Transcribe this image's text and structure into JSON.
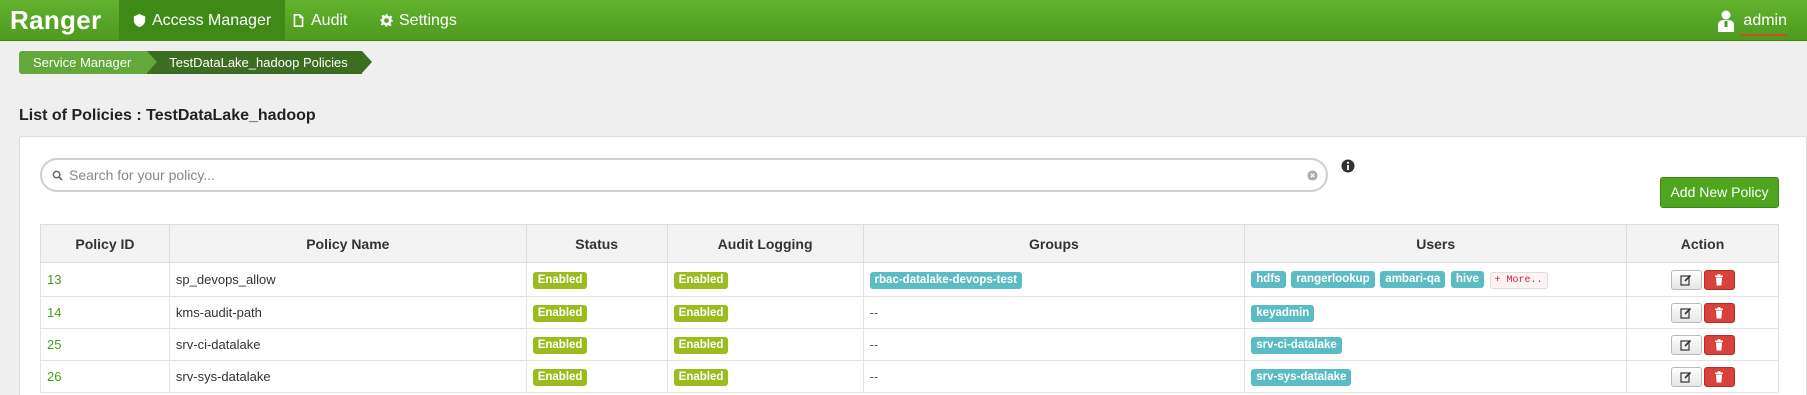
{
  "navbar": {
    "brand": "Ranger",
    "items": [
      {
        "label": "Access Manager",
        "icon": "shield-icon",
        "active": true
      },
      {
        "label": "Audit",
        "icon": "file-icon",
        "active": false
      },
      {
        "label": "Settings",
        "icon": "gear-icon",
        "active": false
      }
    ],
    "user": "admin",
    "accent": "#4e9b1f"
  },
  "breadcrumb": [
    "Service Manager",
    "TestDataLake_hadoop Policies"
  ],
  "page_title": "List of Policies : TestDataLake_hadoop",
  "search": {
    "placeholder": "Search for your policy..."
  },
  "add_button": "Add New Policy",
  "table": {
    "columns": [
      "Policy ID",
      "Policy Name",
      "Status",
      "Audit Logging",
      "Groups",
      "Users",
      "Action"
    ],
    "rows": [
      {
        "id": "13",
        "name": "sp_devops_allow",
        "status": "Enabled",
        "audit": "Enabled",
        "groups": [
          "rbac-datalake-devops-test"
        ],
        "users": [
          "hdfs",
          "rangerlookup",
          "ambari-qa",
          "hive"
        ],
        "more": "+ More.."
      },
      {
        "id": "14",
        "name": "kms-audit-path",
        "status": "Enabled",
        "audit": "Enabled",
        "groups": "--",
        "users": [
          "keyadmin"
        ]
      },
      {
        "id": "25",
        "name": "srv-ci-datalake",
        "status": "Enabled",
        "audit": "Enabled",
        "groups": "--",
        "users": [
          "srv-ci-datalake"
        ]
      },
      {
        "id": "26",
        "name": "srv-sys-datalake",
        "status": "Enabled",
        "audit": "Enabled",
        "groups": "--",
        "users": [
          "srv-sys-datalake"
        ]
      }
    ]
  }
}
